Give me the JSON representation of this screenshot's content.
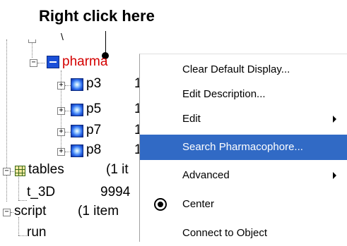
{
  "caption": "Right click here",
  "tree": {
    "rows": [
      {
        "label": "pharma",
        "suffix": ""
      },
      {
        "label": "p3",
        "suffix": "1"
      },
      {
        "label": "p5",
        "suffix": "1"
      },
      {
        "label": "p7",
        "suffix": "1"
      },
      {
        "label": "p8",
        "suffix": "1"
      },
      {
        "label": "tables",
        "suffix": "(1 it"
      },
      {
        "label": "t_3D",
        "suffix": "9994"
      },
      {
        "label": "script",
        "suffix": "(1 item"
      },
      {
        "label": "run",
        "suffix": ""
      }
    ],
    "top_partial": "\\"
  },
  "context_menu": {
    "items": [
      {
        "label": "Clear Default Display...",
        "submenu": false
      },
      {
        "label": "Edit Description...",
        "submenu": false
      },
      {
        "label": "Edit",
        "submenu": true
      },
      {
        "label": "Search Pharmacophore...",
        "submenu": false,
        "highlighted": true
      },
      {
        "label": "Advanced",
        "submenu": true
      },
      {
        "label": "Center",
        "icon": "target-icon"
      },
      {
        "label": "Connect to Object",
        "submenu": false
      }
    ]
  },
  "colors": {
    "highlight": "#316ac5",
    "pharma_label": "#d40000"
  }
}
